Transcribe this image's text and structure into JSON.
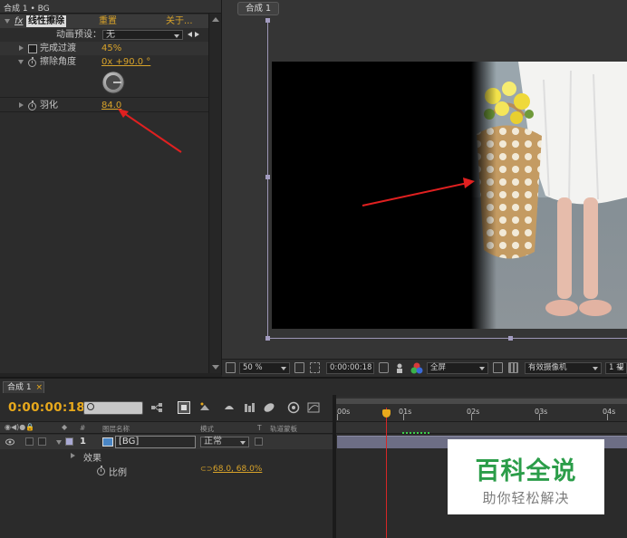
{
  "effect_controls": {
    "title": "合成 1 • BG",
    "effect_name": "线性擦除",
    "reset_label": "重置",
    "about_label": "关于...",
    "animation_preset_label": "动画预设：",
    "animation_preset_value": "无",
    "completion_label": "完成过渡",
    "completion_value": "45%",
    "angle_label": "擦除角度",
    "angle_value": "0x +90.0 °",
    "feather_label": "羽化",
    "feather_value": "84.0"
  },
  "composition": {
    "tab_label": "合成 1"
  },
  "viewer_toolbar": {
    "zoom": "50 %",
    "timecode": "0:00:00:18",
    "resolution": "全屏",
    "camera": "有效摄像机",
    "views": "1 视"
  },
  "timeline": {
    "tab_label": "合成 1",
    "timecode": "0:00:00:18",
    "column_source_name": "图层名称",
    "column_mode": "模式",
    "column_t": "T",
    "column_track_matte": "轨道蒙板",
    "column_number": "#",
    "layer_number": "1",
    "layer_name": "[BG]",
    "layer_mode": "正常",
    "effects_label": "效果",
    "scale_label": "比例",
    "scale_value": "68.0, 68.0%",
    "ruler_labels": [
      "00s",
      "01s",
      "02s",
      "03s",
      "04s"
    ]
  },
  "watermark": {
    "title": "百科全说",
    "subtitle": "助你轻松解决"
  },
  "colors": {
    "accent_orange": "#d8a32a",
    "timecode_orange": "#e8a91c",
    "annotation_red": "#e02020",
    "playhead_red": "#d62727",
    "watermark_green": "#2b9d49"
  }
}
